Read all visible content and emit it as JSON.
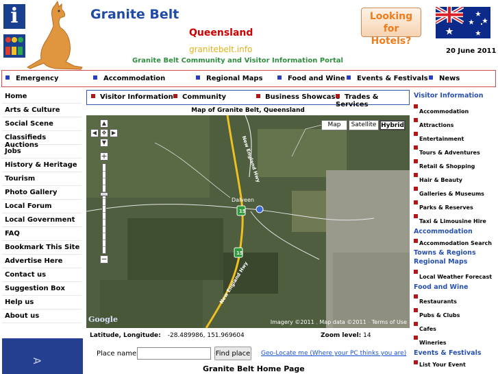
{
  "header": {
    "site_title": "Granite Belt",
    "state": "Queensland",
    "domain": "granitebelt.info",
    "portal_text": "Granite Belt Community and Visitor Information Portal",
    "info_icon_text": "i",
    "hotels_button": "Looking for Hotels?",
    "date": "20 June 2011"
  },
  "top_nav": [
    "Emergency",
    "Accommodation",
    "Regional Maps",
    "Food and Wine",
    "Events & Festivals",
    "News"
  ],
  "left_menu": [
    "Home",
    "Arts & Culture",
    "Social Scene",
    "Classifieds Auctions",
    "Jobs",
    "History & Heritage",
    "Tourism",
    "Photo Gallery",
    "Local Forum",
    "Local Government",
    "FAQ",
    "Bookmark This Site",
    "Advertise Here",
    "Contact us",
    "Suggestion Box",
    "Help us",
    "About us"
  ],
  "left_box_text": "A",
  "sub_nav": [
    "Visitor Information",
    "Community",
    "Business Showcase",
    "Trades & Services"
  ],
  "map": {
    "title": "Map of Granite Belt, Queensland",
    "type_buttons": [
      "Map",
      "Satellite",
      "Hybrid"
    ],
    "active_type": "Hybrid",
    "place_label": "Dalveen",
    "highway_label": "New England Hwy",
    "route_shield": "15",
    "google_logo": "Google",
    "imagery": "Imagery ©2011",
    "map_data": "Map data ©2011",
    "terms": "Terms of Use",
    "zoom_plus": "+",
    "zoom_minus": "−"
  },
  "coords": {
    "label": "Latitude, Longitude:",
    "value": "-28.489986, 151.969604",
    "zoom_label": "Zoom level:",
    "zoom_value": "14"
  },
  "search": {
    "place_label": "Place name:",
    "value": "",
    "button": "Find place",
    "geo_link": "Geo-Locate me (Where your PC thinks you are)"
  },
  "page_heading": "Granite Belt Home Page",
  "right_column": [
    {
      "heading": "Visitor Information",
      "items": [
        "Accommodation",
        "Attractions",
        "Entertainment",
        "Tours & Adventures",
        "Retail & Shopping",
        "Hair & Beauty",
        "Galleries & Museums",
        "Parks & Reserves",
        "Taxi & Limousine Hire"
      ]
    },
    {
      "heading": "Accommodation",
      "items": [
        "Accommodation Search"
      ]
    },
    {
      "heading": "Towns & Regions",
      "items": []
    },
    {
      "heading": "Regional Maps",
      "items": [
        "Local Weather Forecast"
      ]
    },
    {
      "heading": "Food and Wine",
      "items": [
        "Restaurants",
        "Pubs & Clubs",
        "Cafes",
        "Wineries"
      ]
    },
    {
      "heading": "Events & Festivals",
      "items": [
        "List Your Event"
      ]
    }
  ],
  "colors": {
    "title_blue": "#1f4aa6",
    "state_red": "#cc0000",
    "domain_gold": "#e0b21a",
    "portal_green": "#2f8f3f",
    "hotels_orange": "#f07c1c",
    "bullet_blue": "#2a3fc0",
    "bullet_red": "#b01818"
  },
  "icons": [
    "info-icon",
    "visitor-info-icon",
    "kangaroo-logo",
    "australian-flag"
  ]
}
